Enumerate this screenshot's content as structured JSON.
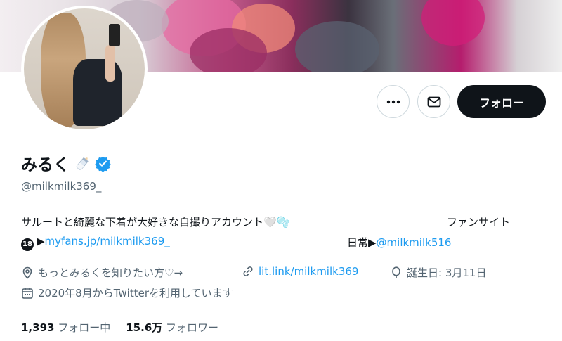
{
  "profile": {
    "name": "みるく",
    "handle": "@milkmilk369_",
    "follow_label": "フォロー",
    "bio": {
      "line1_text": "サルートと綺麗な下着が大好きな自撮りアカウント🤍🫧",
      "line1_right": "ファンサイト",
      "r18_mark": "18",
      "line2_arrow": "▶",
      "line2_link": "myfans.jp/milkmilk369_",
      "line2_right_text": "日常▶",
      "line2_right_link": "@milkmilk516"
    },
    "meta": {
      "location": "もっとみるくを知りたい方♡→",
      "website": "lit.link/milkmilk369",
      "birthday": "誕生日: 3月11日",
      "joined": "2020年8月からTwitterを利用しています"
    },
    "stats": {
      "following_count": "1,393",
      "following_label": "フォロー中",
      "followers_count": "15.6万",
      "followers_label": "フォロワー"
    }
  },
  "colors": {
    "link": "#1d9bf0",
    "verified": "#1d9bf0",
    "button_dark": "#0f1419",
    "muted": "#536471"
  },
  "icons": [
    "more-icon",
    "mail-icon",
    "verified-badge-icon",
    "baby-bottle-icon",
    "location-icon",
    "link-icon",
    "balloon-icon",
    "calendar-icon"
  ]
}
